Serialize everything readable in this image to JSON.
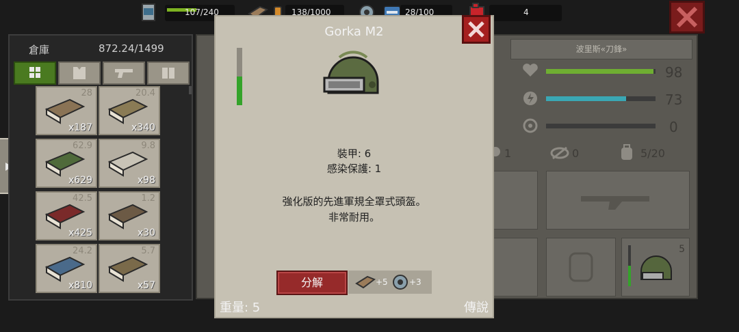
{
  "resources": {
    "food": {
      "value": "107/240",
      "fraction": 0.45,
      "icon": "food-can-icon"
    },
    "wood": {
      "value": "138/1000",
      "icon": "wood-plank-icon"
    },
    "parts": {
      "value": "28/100",
      "icon": "gear-icon"
    },
    "fuel": {
      "value": "4",
      "icon": "fuel-canister-icon"
    }
  },
  "storage": {
    "title": "倉庫",
    "capacity": "872.24/1499",
    "tabs": [
      "grid-icon",
      "armor-vest-icon",
      "pistol-icon",
      "ammo-icon"
    ],
    "items": [
      {
        "icon": "wood-bundle-icon",
        "weight": "28",
        "count": "x187"
      },
      {
        "icon": "cloth-bundle-icon",
        "weight": "20.4",
        "count": "x340"
      },
      {
        "icon": "green-cloth-bundle-icon",
        "weight": "62.9",
        "count": "x629"
      },
      {
        "icon": "medkit-icon",
        "weight": "9.8",
        "count": "x98"
      },
      {
        "icon": "red-cloth-bundle-icon",
        "weight": "42.5",
        "count": "x425"
      },
      {
        "icon": "bullet-box-icon",
        "weight": "1.2",
        "count": "x30"
      },
      {
        "icon": "blue-cloth-bundle-icon",
        "weight": "24.2",
        "count": "x810"
      },
      {
        "icon": "spear-icon",
        "weight": "5.7",
        "count": "x57"
      }
    ]
  },
  "character": {
    "name": "波里斯«刀鋒»",
    "health": {
      "value": "98",
      "fraction": 0.98,
      "color": "#6fae32"
    },
    "stamina": {
      "value": "73",
      "fraction": 0.73,
      "color": "#3aa7b4"
    },
    "infection": {
      "value": "0",
      "fraction": 0
    },
    "stat1": "1",
    "stat2": "0",
    "stat3": "5/20",
    "equip_helmet_count": "5"
  },
  "dialog": {
    "title": "Gorka M2",
    "armor": "裝甲: 6",
    "infection": "感染保護: 1",
    "desc1": "強化版的先進軍規全罩式頭盔。",
    "desc2": "非常耐用。",
    "dismantle": "分解",
    "yield_wood": "+5",
    "yield_parts": "+3",
    "weight": "重量: 5",
    "rarity": "傳說",
    "durability": 0.5
  }
}
